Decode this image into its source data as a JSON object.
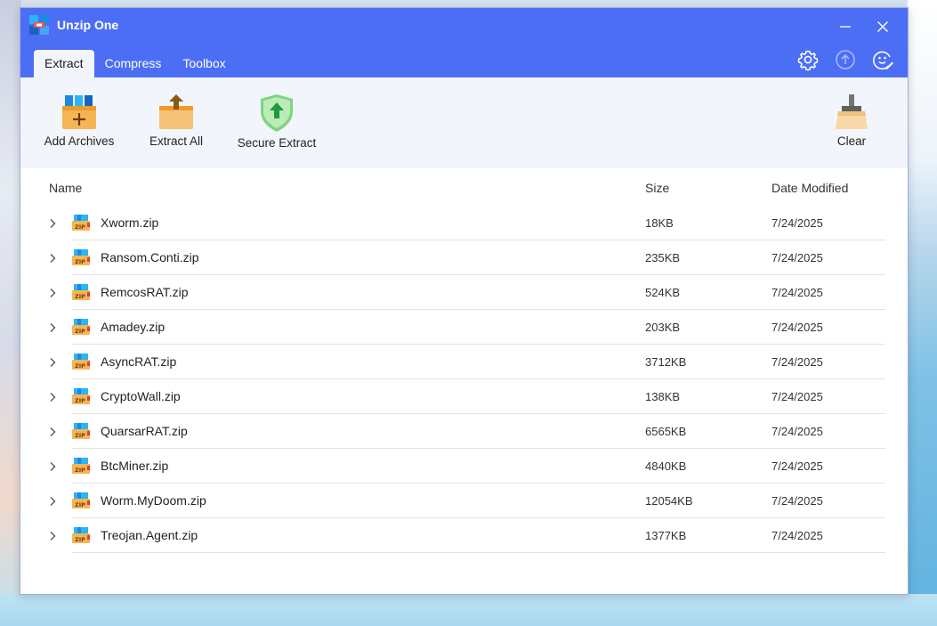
{
  "window": {
    "title": "Unzip One",
    "colors": {
      "titlebar": "#4c6ef5",
      "toolbar_bg": "#f2f5fb"
    }
  },
  "tabs": [
    {
      "label": "Extract",
      "active": true
    },
    {
      "label": "Compress",
      "active": false
    },
    {
      "label": "Toolbox",
      "active": false
    }
  ],
  "header_icons": [
    "gear-icon",
    "upload-icon",
    "feedback-icon"
  ],
  "toolbar": {
    "add_archives": "Add Archives",
    "extract_all": "Extract All",
    "secure_extract": "Secure Extract",
    "clear": "Clear"
  },
  "list": {
    "columns": {
      "name": "Name",
      "size": "Size",
      "date": "Date Modified"
    },
    "rows": [
      {
        "name": "Xworm.zip",
        "size": "18KB",
        "date": "7/24/2025"
      },
      {
        "name": "Ransom.Conti.zip",
        "size": "235KB",
        "date": "7/24/2025"
      },
      {
        "name": "RemcosRAT.zip",
        "size": "524KB",
        "date": "7/24/2025"
      },
      {
        "name": "Amadey.zip",
        "size": "203KB",
        "date": "7/24/2025"
      },
      {
        "name": "AsyncRAT.zip",
        "size": "3712KB",
        "date": "7/24/2025"
      },
      {
        "name": "CryptoWall.zip",
        "size": "138KB",
        "date": "7/24/2025"
      },
      {
        "name": "QuarsarRAT.zip",
        "size": "6565KB",
        "date": "7/24/2025"
      },
      {
        "name": "BtcMiner.zip",
        "size": "4840KB",
        "date": "7/24/2025"
      },
      {
        "name": "Worm.MyDoom.zip",
        "size": "12054KB",
        "date": "7/24/2025"
      },
      {
        "name": "Treojan.Agent.zip",
        "size": "1377KB",
        "date": "7/24/2025"
      }
    ]
  }
}
